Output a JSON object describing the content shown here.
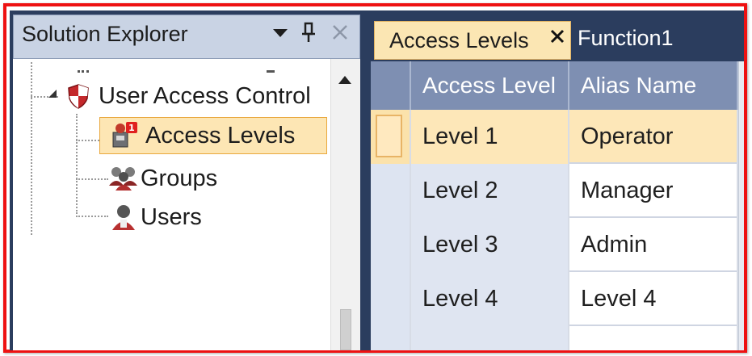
{
  "explorer": {
    "title": "Solution Explorer",
    "tree": {
      "root": {
        "label": "User Access Control",
        "icon": "shield-icon"
      },
      "children": [
        {
          "label": "Access Levels",
          "icon": "access-levels-icon",
          "selected": true
        },
        {
          "label": "Groups",
          "icon": "groups-icon",
          "selected": false
        },
        {
          "label": "Users",
          "icon": "users-icon",
          "selected": false
        }
      ]
    }
  },
  "tabs": [
    {
      "label": "Access Levels",
      "active": true,
      "closable": true
    },
    {
      "label": "Function1",
      "active": false,
      "closable": false
    }
  ],
  "grid": {
    "columns": [
      "Access Level",
      "Alias Name"
    ],
    "rows": [
      [
        "Level 1",
        "Operator"
      ],
      [
        "Level 2",
        "Manager"
      ],
      [
        "Level 3",
        "Admin"
      ],
      [
        "Level 4",
        "Level 4"
      ]
    ],
    "selected_row": 0
  },
  "colors": {
    "frame_border": "#ee1111",
    "chrome": "#2b3d5e",
    "selection": "#fde6b4",
    "grid_header": "#7e8fb2"
  }
}
